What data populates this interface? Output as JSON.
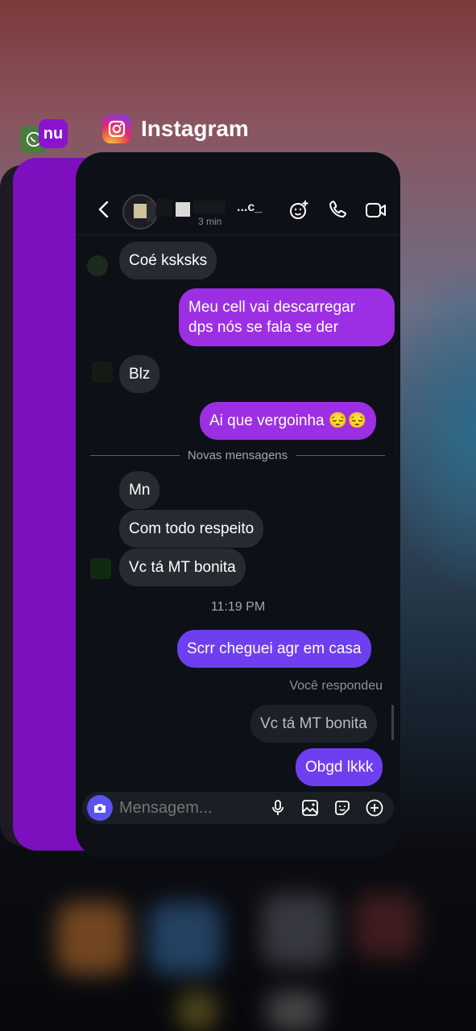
{
  "app_switcher": {
    "app_name": "Instagram"
  },
  "other_apps": {
    "nubank_label": "nu"
  },
  "chat": {
    "header": {
      "status": "3 min",
      "name_partial": "...c_"
    },
    "messages": [
      {
        "text": "Coé ksksks",
        "direction": "in"
      },
      {
        "text": "Meu cell vai descarregar",
        "text2": "dps nós se fala se der",
        "direction": "out"
      },
      {
        "text": "Blz",
        "direction": "in"
      },
      {
        "text": "Ai que vergoinha 😔😔",
        "direction": "out"
      },
      {
        "text": "Mn",
        "direction": "in"
      },
      {
        "text": "Com todo respeito",
        "direction": "in"
      },
      {
        "text": "Vc tá MT bonita",
        "direction": "in"
      },
      {
        "text": "Scrr cheguei agr em casa",
        "direction": "out"
      },
      {
        "text": "Vc tá MT bonita",
        "direction": "reply-quote"
      },
      {
        "text": "Obgd lkkk",
        "direction": "out"
      }
    ],
    "divider_label": "Novas mensagens",
    "timestamp": "11:19 PM",
    "replied_label": "Você respondeu",
    "composer": {
      "placeholder": "Mensagem..."
    }
  },
  "colors": {
    "bubble_in": "#262a31",
    "bubble_out_purple": "#9c2fe3",
    "bubble_out_violet": "#6d3ff0",
    "background": "#0d1016"
  },
  "icons": [
    "back-arrow-icon",
    "sticker-add-icon",
    "phone-icon",
    "video-icon",
    "camera-icon",
    "microphone-icon",
    "gallery-icon",
    "sticker-icon",
    "plus-circle-icon"
  ]
}
